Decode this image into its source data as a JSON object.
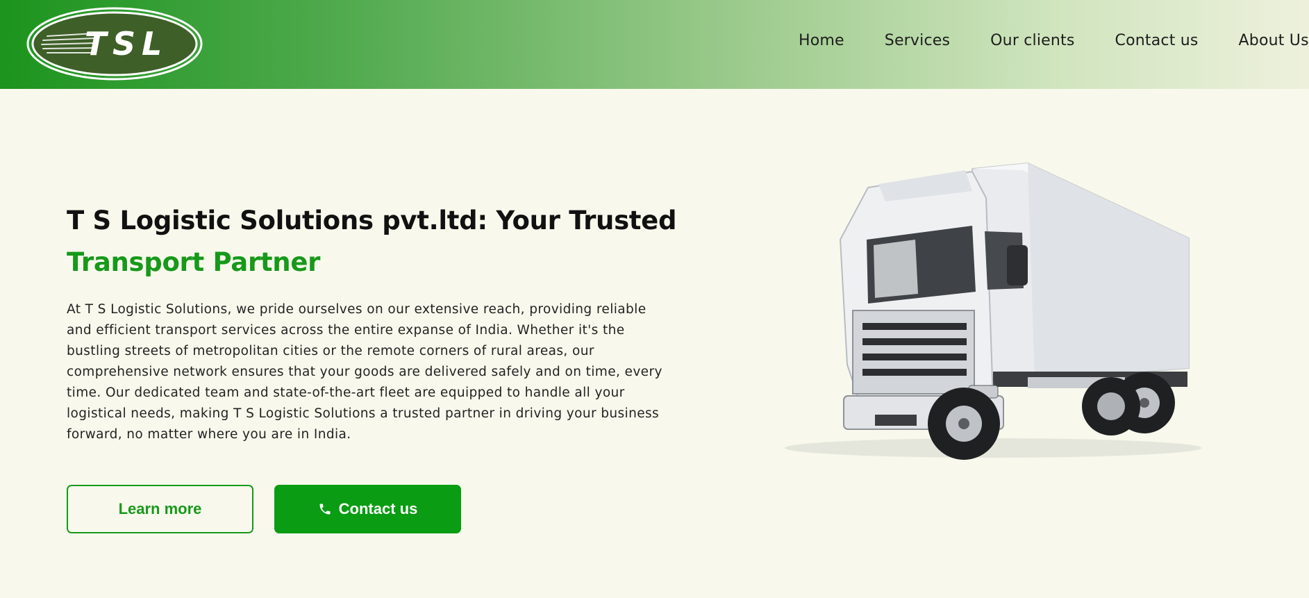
{
  "header": {
    "logo_text": "TSL",
    "nav": [
      "Home",
      "Services",
      "Our clients",
      "Contact us",
      "About Us"
    ]
  },
  "hero": {
    "title_part1": "T S Logistic Solutions pvt.ltd: Your Trusted",
    "title_accent": "Transport Partner",
    "body": "At T S Logistic Solutions, we pride ourselves on our extensive reach, providing reliable and efficient transport services across the entire expanse of India. Whether it's the bustling streets of metropolitan cities or the remote corners of rural areas, our comprehensive network ensures that your goods are delivered safely and on time, every time. Our dedicated team and state-of-the-art fleet are equipped to handle all your logistical needs, making T S Logistic Solutions a trusted partner in driving your business forward, no matter where you are in India.",
    "learn_more_label": "Learn more",
    "contact_label": "Contact us"
  },
  "colors": {
    "brand_green": "#17991a",
    "button_green": "#0a9c12",
    "background": "#f8f9ec",
    "logo_dark": "#3e5f28"
  },
  "icons": {
    "contact_button_icon": "phone-icon"
  }
}
